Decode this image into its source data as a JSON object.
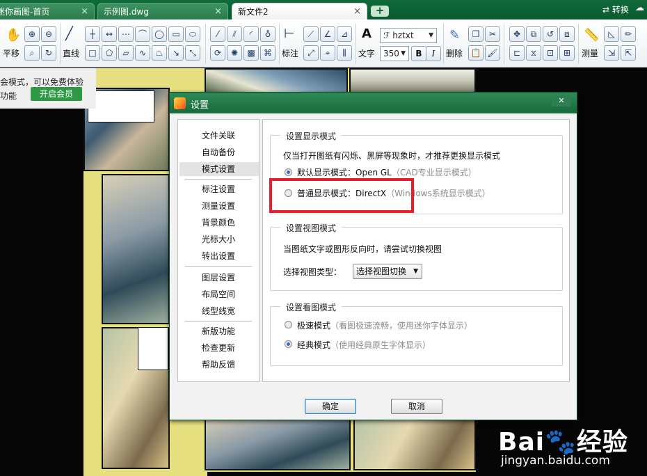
{
  "tabs": [
    {
      "label": "迷你画图-首页"
    },
    {
      "label": "示例图.dwg"
    },
    {
      "label": "新文件2"
    }
  ],
  "tab_close_glyph": "×",
  "tab_add_glyph": "+",
  "titlebar": {
    "convert_label": "转换"
  },
  "toolbar": {
    "pan_label": "平移",
    "line_label": "直线",
    "dimension_label": "标注",
    "text_label": "文字",
    "delete_label": "删除",
    "measure_label": "测量",
    "font_name": "hztxt",
    "font_size": "350",
    "bold_label": "B",
    "italic_label": "I"
  },
  "vip_banner": {
    "line1": "会模式，可以免费体验",
    "line2": "功能",
    "button": "开启会员"
  },
  "dialog": {
    "title": "设置",
    "close_glyph": "✕",
    "nav_items": [
      "文件关联",
      "自动备份",
      "模式设置",
      "标注设置",
      "测量设置",
      "背景颜色",
      "光标大小",
      "转出设置",
      "图层设置",
      "布局空间",
      "线型线宽",
      "新版功能",
      "检查更新",
      "帮助反馈"
    ],
    "selected_nav": "模式设置",
    "display_mode": {
      "title": "设置显示模式",
      "hint": "仅当打开图纸有闪烁、黑屏等现象时，才推荐更换显示模式",
      "option1": "默认显示模式：Open GL",
      "option1_note": "（CAD专业显示模式）",
      "option2": "普通显示模式：DirectX",
      "option2_note": "（Windows系统显示模式）",
      "selected": "option1"
    },
    "view_mode": {
      "title": "设置视图模式",
      "hint": "当图纸文字或图形反向时，请尝试切换视图",
      "select_label": "选择视图类型：",
      "select_value": "选择视图切换"
    },
    "view_style": {
      "title": "设置看图模式",
      "option1": "极速模式",
      "option1_note": "（看图极速流畅，使用迷你字体显示）",
      "option2": "经典模式",
      "option2_note": "（使用经典原生字体显示）",
      "selected": "option2"
    },
    "ok_label": "确定",
    "cancel_label": "取消"
  },
  "watermark": {
    "logo": "Bai🐾经验",
    "url": "jingyan.baidu.com"
  },
  "accent_colors": {
    "brand_green": "#17693c",
    "highlight_red": "#e5202a",
    "radio_blue": "#3b6fc7"
  }
}
